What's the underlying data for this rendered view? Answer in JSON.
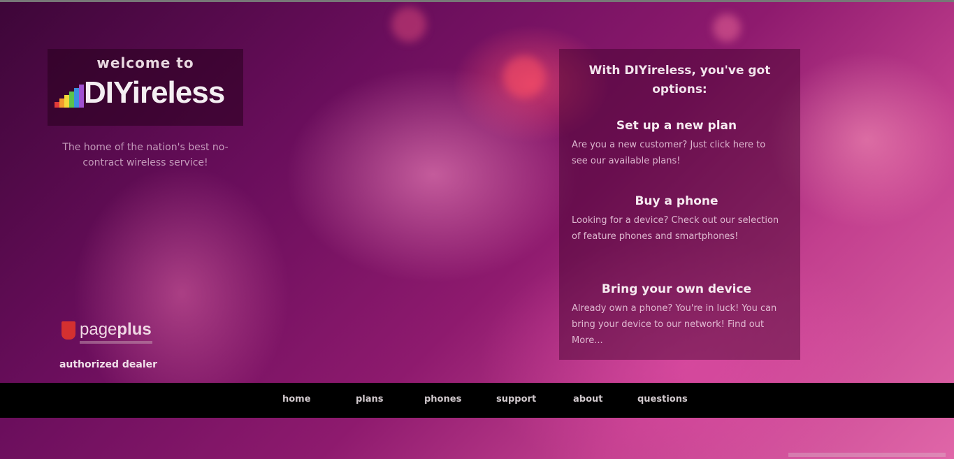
{
  "welcome": {
    "intro": "welcome to",
    "logo_text": "DIYireless",
    "tagline": "The home of the nation's best no-contract wireless service!",
    "bar_colors": [
      "#e03a3a",
      "#f29a2e",
      "#f4d83a",
      "#5cc24a",
      "#3a8fe0",
      "#a050d0"
    ]
  },
  "dealer": {
    "brand_light": "page",
    "brand_bold": "plus",
    "label": "authorized dealer",
    "brand_color": "#d43030"
  },
  "options": {
    "header": "With DIYireless, you've got options:",
    "items": [
      {
        "title": "Set up a new plan",
        "description": "Are you a new customer? Just click here to see our available plans!"
      },
      {
        "title": "Buy a phone",
        "description": "Looking for a device? Check out our selection of feature phones and smartphones!"
      },
      {
        "title": "Bring your own device",
        "description": "Already own a phone? You're in luck! You can bring your device to our network! Find out More..."
      }
    ]
  },
  "nav": {
    "items": [
      "home",
      "plans",
      "phones",
      "support",
      "about",
      "questions"
    ]
  },
  "colors": {
    "navbar_bg": "#000000",
    "accent_pink": "#c23f8e",
    "deep_purple": "#3d0638"
  }
}
